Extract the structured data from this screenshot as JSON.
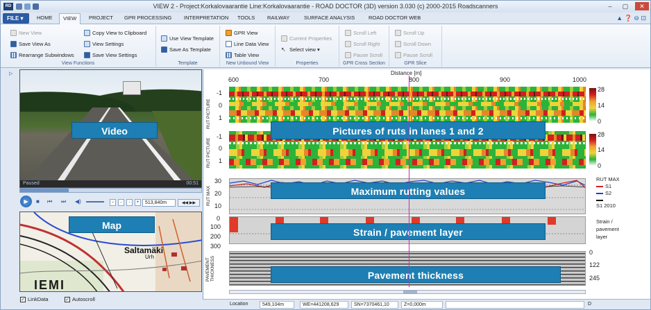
{
  "window": {
    "title": "VIEW 2 - Project:Korkalovaarantie Line:Korkalovaarantie - ROAD DOCTOR (3D) version 3.030 (c) 2000-2015 Roadscanners",
    "app_icon": "RD"
  },
  "window_buttons": {
    "minimize": "–",
    "maximize": "▢",
    "close": "✕"
  },
  "tabs": {
    "file": "FILE ▾",
    "items": [
      "HOME",
      "VIEW",
      "PROJECT",
      "GPR PROCESSING",
      "INTERPRETATION",
      "TOOLS",
      "RAILWAY",
      "SURFACE ANALYSIS",
      "ROAD DOCTOR WEB"
    ],
    "active": "VIEW"
  },
  "ribbon_right_icons": "▲ ❓ ⊖ ⊡",
  "ribbon": {
    "view_functions": {
      "title": "View Functions",
      "new_view": "New View",
      "save_view_as": "Save View As",
      "rearrange": "Rearrange Subwindows",
      "copy_view": "Copy View to Clipboard",
      "view_settings": "View Settings",
      "save_view_settings": "Save View Settings"
    },
    "template": {
      "title": "Template",
      "use_view_template": "Use View Template",
      "save_as_template": "Save As Template"
    },
    "new_unbound_view": {
      "title": "New Unbound View",
      "gpr_view": "GPR View",
      "line_data_view": "Line Data View",
      "table_view": "Table View"
    },
    "properties": {
      "title": "Properties",
      "current_properties": "Current Properties",
      "select_view": "Select view ▾"
    },
    "gpr_cross_section": {
      "title": "GPR Cross Section",
      "scroll_left": "Scroll Left",
      "scroll_right": "Scroll Right",
      "pause_scroll": "Pause Scroll"
    },
    "gpr_slice": {
      "title": "GPR Slice",
      "scroll_up": "Scroll Up",
      "scroll_down": "Scroll Down",
      "pause_scroll": "Pause Scroll"
    }
  },
  "video": {
    "label": "Video",
    "status": "Paused",
    "time": "00:51",
    "position": "513,840m",
    "progress": 0.27,
    "btn_minus": "−",
    "btn_plus": "+",
    "nav": "◀◀ ▶▶"
  },
  "map": {
    "label": "Map",
    "place": "Saltamäki",
    "place2": "Urh",
    "watermark": "IEMI"
  },
  "checkboxes": {
    "linkdata": "LinkData",
    "autoscroll": "Autoscroll"
  },
  "chart_data": {
    "type": "heatmap",
    "xlabel": "Distance [m]",
    "x_ticks": [
      "600",
      "700",
      "800",
      "900",
      "1000"
    ],
    "panels": [
      {
        "ylabel": "RUT PICTURE",
        "yticks": [
          "-1",
          "0",
          "1"
        ],
        "colorbar": [
          "28",
          "14",
          "0"
        ],
        "label": "Pictures of ruts in lanes 1 and 2"
      },
      {
        "ylabel": "RUT PICTURE",
        "yticks": [
          "-1",
          "0",
          "1"
        ],
        "colorbar": [
          "28",
          "14",
          "0"
        ]
      },
      {
        "ylabel": "RUT MAX",
        "yticks": [
          "30",
          "20",
          "10"
        ],
        "legend": [
          "RUT MAX",
          "S1",
          "S2",
          "S1 2010"
        ],
        "label": "Maximum rutting values"
      },
      {
        "ylabel": "",
        "yticks": [
          "0",
          "100",
          "200",
          "300"
        ],
        "legend": [
          "Strain /",
          "pavement",
          "layer"
        ],
        "label": "Strain / pavement layer"
      },
      {
        "ylabel": "PAVEMENT THICKNESS",
        "yticks": [
          "0",
          "122",
          "245"
        ],
        "label": "Pavement thickness"
      }
    ],
    "colors": {
      "rut_s1": "#d22020",
      "rut_s2": "#2040d0",
      "rut_s1_2010": "#111111",
      "strain": "#e03a2a",
      "cursor": "#c02cc0"
    }
  },
  "statusbar": {
    "location_label": "Location",
    "location": "549,104m",
    "we": "WE=441208,629",
    "sn": "SN=7370461,10",
    "z": "Z=0,000m",
    "d": "D"
  }
}
